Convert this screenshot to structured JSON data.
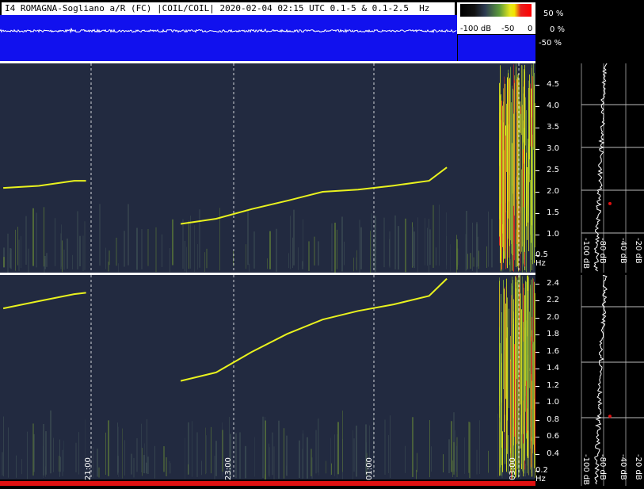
{
  "header": {
    "title": "I4 ROMAGNA-Sogliano a/R (FC) |COIL/COIL| 2020-02-04 02:15 UTC 0.1-5 & 0.1-2.5  Hz",
    "scale_min": "-100 dB",
    "scale_mid": "-50",
    "scale_max": "0"
  },
  "waveform": {
    "pct_labels": [
      "50 %",
      "0 %",
      "-50 %"
    ]
  },
  "colors": {
    "waveform_bg": "#1111ee",
    "spectrogram_bg": "#222a40",
    "trace": "#e9f21e",
    "accent_red": "#e01010"
  },
  "chart_data": [
    {
      "type": "heatmap",
      "title": "",
      "xlabel": "",
      "ylabel": "Hz",
      "ylim": [
        0.1,
        5.0
      ],
      "yticks": [
        "4.5",
        "4.0",
        "3.5",
        "3.0",
        "2.5",
        "2.0",
        "1.5",
        "1.0",
        "0.5 Hz"
      ],
      "x_ticks": [
        "21:00",
        "23:00",
        "01:00",
        "03:00"
      ],
      "trace": {
        "name": "",
        "x": [
          "20:00",
          "20:30",
          "21:00",
          "21:10",
          "21:30",
          "22:00",
          "22:30",
          "23:00",
          "23:30",
          "00:00",
          "00:30",
          "01:00",
          "01:30",
          "02:00",
          "02:15"
        ],
        "y": [
          2.1,
          2.15,
          2.25,
          2.27,
          null,
          null,
          1.25,
          1.35,
          1.6,
          1.8,
          1.98,
          2.05,
          2.15,
          2.25,
          2.55
        ]
      }
    },
    {
      "type": "heatmap",
      "title": "",
      "xlabel": "",
      "ylabel": "Hz",
      "ylim": [
        0.1,
        2.5
      ],
      "yticks": [
        "2.4",
        "2.2",
        "2.0",
        "1.8",
        "1.6",
        "1.4",
        "1.2",
        "1.0",
        "0.8",
        "0.6",
        "0.4",
        "0.2 Hz"
      ],
      "x_ticks": [
        "21:00",
        "23:00",
        "01:00",
        "03:00"
      ],
      "trace": {
        "name": "",
        "x": [
          "20:00",
          "20:30",
          "21:00",
          "21:10",
          "21:30",
          "22:00",
          "22:30",
          "23:00",
          "23:30",
          "00:00",
          "00:30",
          "01:00",
          "01:30",
          "02:00",
          "02:15"
        ],
        "y": [
          2.1,
          2.2,
          2.27,
          2.3,
          null,
          null,
          1.25,
          1.35,
          1.6,
          1.8,
          1.98,
          2.08,
          2.15,
          2.25,
          2.45
        ]
      }
    },
    {
      "type": "line",
      "title": "",
      "xlabel": "",
      "ylabel": "",
      "x_ticks": [
        "-100 dB",
        "-80 dB",
        "-40 dB",
        "-20 dB"
      ]
    }
  ]
}
